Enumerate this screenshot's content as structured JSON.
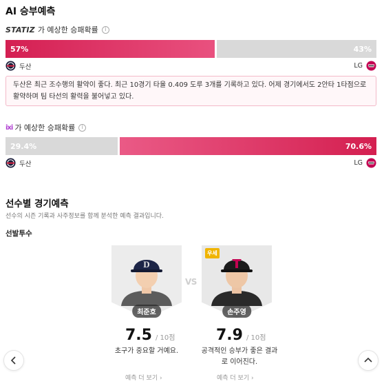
{
  "ai_prediction": {
    "title": "AI 승부예측",
    "statiz": {
      "brand": "STATIZ",
      "label": "가 예상한 승패확률",
      "home_pct_label": "57%",
      "away_pct_label": "43%",
      "home_pct": 57,
      "away_pct": 43
    },
    "teams": {
      "home": "두산",
      "away": "LG"
    },
    "analysis": "두산은 최근 조수행의 활약이 좋다. 최근 10경기 타율 0.409 도루 3개를 기록하고 있다. 어제 경기에서도 2안타 1타점으로 활약하며 팀 타선의 활력을 불어넣고 있다.",
    "second": {
      "brand": "ixi",
      "label": "가 예상한 승패확률",
      "home_pct_label": "29.4%",
      "away_pct_label": "70.6%",
      "home_pct": 29.4,
      "away_pct": 70.6
    }
  },
  "player_prediction": {
    "title": "선수별 경기예측",
    "description": "선수의 시즌 기록과 사주정보를 함께 분석한 예측 결과입니다.",
    "subheading": "선발투수",
    "vs": "VS",
    "players": [
      {
        "name": "최준호",
        "score": "7.5",
        "score_unit": "/ 10점",
        "comment": "초구가 중요할 거예요.",
        "more": "예측 더 보기 ›",
        "badge": ""
      },
      {
        "name": "손주영",
        "score": "7.9",
        "score_unit": "/ 10점",
        "comment": "공격적인 승부가 좋은 결과로 이어진다.",
        "more": "예측 더 보기 ›",
        "badge": "우세"
      }
    ]
  },
  "icons": {
    "info": "info-icon",
    "prev": "chevron-left-icon",
    "top": "chevron-up-icon",
    "doosan_logo": "doosan-logo-icon",
    "lg_logo": "lg-twins-logo-icon"
  },
  "colors": {
    "accent": "#d41f52",
    "gray_bar": "#d9d9d9",
    "badge": "#f0b400"
  }
}
